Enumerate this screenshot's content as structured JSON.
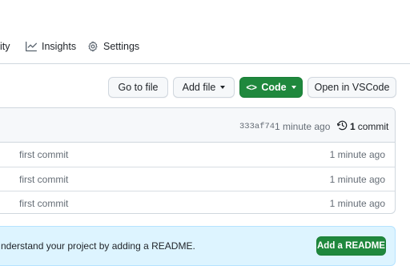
{
  "nav": {
    "partial_label": "ity",
    "insights_label": "Insights",
    "settings_label": "Settings"
  },
  "actions": {
    "goto_label": "Go to file",
    "addfile_label": "Add file",
    "code_label": "Code",
    "code_glyph": "<>",
    "vscode_label": "Open in VSCode"
  },
  "latest_commit": {
    "sha": "333af74",
    "time": "1 minute ago",
    "count": "1",
    "count_word": "commit"
  },
  "files": [
    {
      "message": "first commit",
      "time": "1 minute ago"
    },
    {
      "message": "first commit",
      "time": "1 minute ago"
    },
    {
      "message": "first commit",
      "time": "1 minute ago"
    }
  ],
  "readme_banner": {
    "text": "nderstand your project by adding a README.",
    "button_label": "Add a README"
  },
  "colors": {
    "primary_green": "#1f883d",
    "banner_blue": "#ddf4ff",
    "border": "#d0d7de"
  }
}
